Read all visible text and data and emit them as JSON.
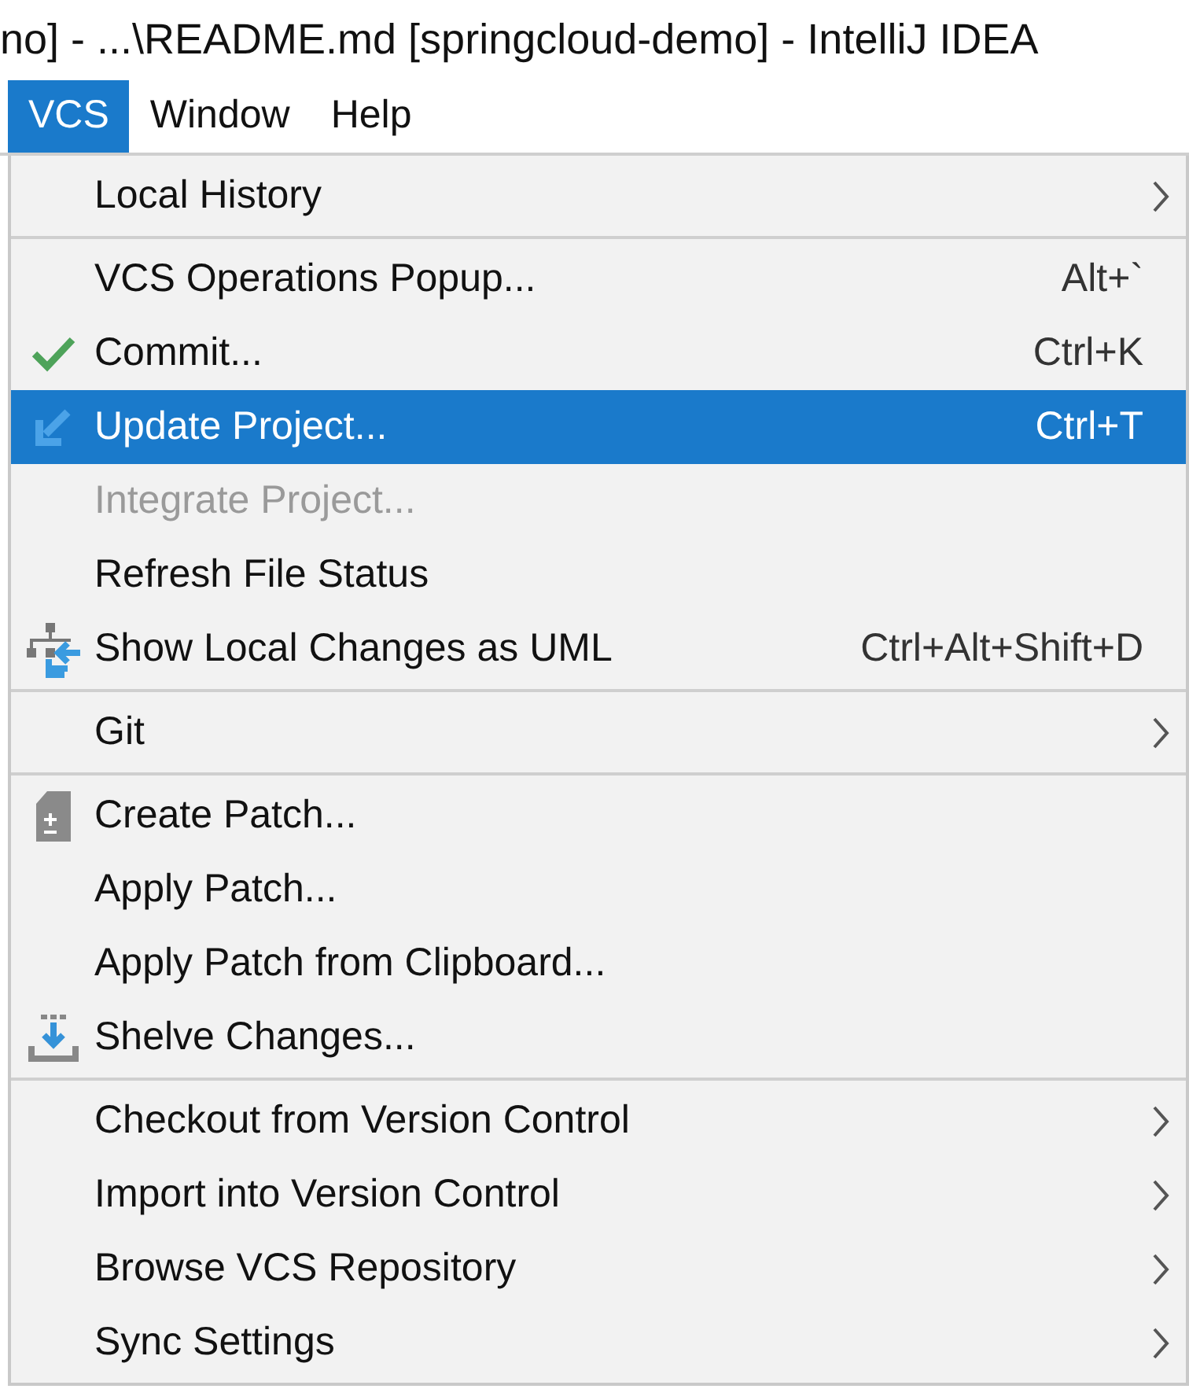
{
  "window": {
    "title": "no] - ...\\README.md [springcloud-demo] - IntelliJ IDEA"
  },
  "menubar": [
    {
      "label": "VCS",
      "selected": true
    },
    {
      "label": "Window",
      "selected": false
    },
    {
      "label": "Help",
      "selected": false
    }
  ],
  "menu": {
    "sections": [
      [
        {
          "label": "Local History",
          "kind": "plain",
          "submenu": true,
          "disabled": false,
          "selected": false
        }
      ],
      [
        {
          "label": "VCS Operations Popup...",
          "kind": "plain",
          "shortcut": "Alt+`",
          "submenu": false,
          "disabled": false,
          "selected": false
        },
        {
          "label": "Commit...",
          "kind": "check",
          "shortcut": "Ctrl+K",
          "submenu": false,
          "disabled": false,
          "selected": false
        },
        {
          "label": "Update Project...",
          "kind": "update",
          "shortcut": "Ctrl+T",
          "submenu": false,
          "disabled": false,
          "selected": true
        },
        {
          "label": "Integrate Project...",
          "kind": "plain",
          "submenu": false,
          "disabled": true,
          "selected": false
        },
        {
          "label": "Refresh File Status",
          "kind": "plain",
          "submenu": false,
          "disabled": false,
          "selected": false
        },
        {
          "label": "Show Local Changes as UML",
          "kind": "uml",
          "shortcut": "Ctrl+Alt+Shift+D",
          "submenu": false,
          "disabled": false,
          "selected": false
        }
      ],
      [
        {
          "label": "Git",
          "kind": "plain",
          "submenu": true,
          "disabled": false,
          "selected": false
        }
      ],
      [
        {
          "label": "Create Patch...",
          "kind": "patch",
          "submenu": false,
          "disabled": false,
          "selected": false
        },
        {
          "label": "Apply Patch...",
          "kind": "plain",
          "submenu": false,
          "disabled": false,
          "selected": false
        },
        {
          "label": "Apply Patch from Clipboard...",
          "kind": "plain",
          "submenu": false,
          "disabled": false,
          "selected": false
        },
        {
          "label": "Shelve Changes...",
          "kind": "shelve",
          "submenu": false,
          "disabled": false,
          "selected": false
        }
      ],
      [
        {
          "label": "Checkout from Version Control",
          "kind": "plain",
          "submenu": true,
          "disabled": false,
          "selected": false
        },
        {
          "label": "Import into Version Control",
          "kind": "plain",
          "submenu": true,
          "disabled": false,
          "selected": false
        },
        {
          "label": "Browse VCS Repository",
          "kind": "plain",
          "submenu": true,
          "disabled": false,
          "selected": false
        },
        {
          "label": "Sync Settings",
          "kind": "plain",
          "submenu": true,
          "disabled": false,
          "selected": false
        }
      ]
    ]
  }
}
